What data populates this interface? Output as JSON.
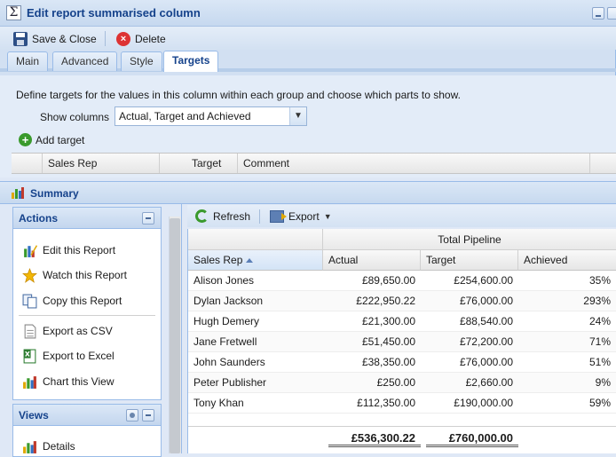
{
  "dialog": {
    "title": "Edit report summarised column",
    "icon": "sigma-icon",
    "toolbar": {
      "save_label": "Save & Close",
      "delete_label": "Delete"
    },
    "tabs": [
      {
        "label": "Main",
        "active": false
      },
      {
        "label": "Advanced",
        "active": false
      },
      {
        "label": "Style",
        "active": false
      },
      {
        "label": "Targets",
        "active": true
      }
    ],
    "targets": {
      "description": "Define targets for the values in this column within each group and choose which parts to show.",
      "show_columns_label": "Show columns",
      "show_columns_value": "Actual, Target and Achieved",
      "add_target_label": "Add target",
      "grid_headers": [
        "",
        "Sales Rep",
        "Target",
        "Comment"
      ]
    }
  },
  "report": {
    "title": "Summary",
    "actions": {
      "title": "Actions",
      "items": [
        {
          "label": "Edit this Report",
          "icon": "edit-report-icon"
        },
        {
          "label": "Watch this Report",
          "icon": "star-icon"
        },
        {
          "label": "Copy this Report",
          "icon": "copy-icon"
        },
        {
          "label": "Export as CSV",
          "icon": "csv-icon"
        },
        {
          "label": "Export to Excel",
          "icon": "excel-icon"
        },
        {
          "label": "Chart this View",
          "icon": "chart-icon"
        }
      ]
    },
    "views": {
      "title": "Views",
      "items": [
        {
          "label": "Details",
          "icon": "details-icon"
        }
      ]
    },
    "grid_toolbar": {
      "refresh_label": "Refresh",
      "export_label": "Export"
    },
    "grid": {
      "group_header": "Total Pipeline",
      "columns": [
        "Sales Rep",
        "Actual",
        "Target",
        "Achieved"
      ],
      "rows": [
        [
          "Alison Jones",
          "£89,650.00",
          "£254,600.00",
          "35%"
        ],
        [
          "Dylan Jackson",
          "£222,950.22",
          "£76,000.00",
          "293%"
        ],
        [
          "Hugh Demery",
          "£21,300.00",
          "£88,540.00",
          "24%"
        ],
        [
          "Jane Fretwell",
          "£51,450.00",
          "£72,200.00",
          "71%"
        ],
        [
          "John Saunders",
          "£38,350.00",
          "£76,000.00",
          "51%"
        ],
        [
          "Peter Publisher",
          "£250.00",
          "£2,660.00",
          "9%"
        ],
        [
          "Tony Khan",
          "£112,350.00",
          "£190,000.00",
          "59%"
        ]
      ],
      "totals": {
        "actual": "£536,300.22",
        "target": "£760,000.00"
      }
    }
  },
  "colors": {
    "accent": "#15428b",
    "border": "#99bbe8",
    "panel": "#dfe8f6"
  }
}
